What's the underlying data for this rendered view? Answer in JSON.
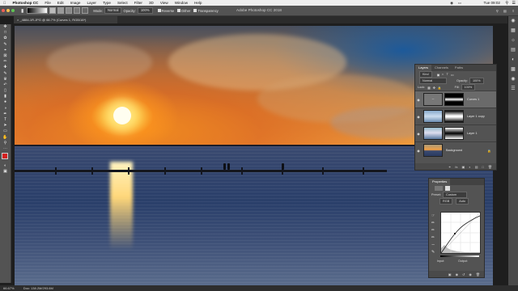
{
  "menubar": {
    "app": "Photoshop CC",
    "items": [
      "File",
      "Edit",
      "Image",
      "Layer",
      "Type",
      "Select",
      "Filter",
      "3D",
      "View",
      "Window",
      "Help"
    ],
    "clock": "Tue 09:02"
  },
  "window": {
    "title": "Adobe Photoshop CC 2018"
  },
  "options": {
    "mode_label": "Mode:",
    "mode_value": "Normal",
    "opacity_label": "Opacity:",
    "opacity_value": "100%",
    "reverse_label": "Reverse",
    "dither_label": "Dither",
    "transparency_label": "Transparency"
  },
  "document_tab": {
    "label": "_4884-1R.JPG @ 66.7% (Curves 1, RGB/16*)"
  },
  "layers_panel": {
    "tabs": [
      "Layers",
      "Channels",
      "Paths"
    ],
    "kind_label": "Kind",
    "blend_mode": "Normal",
    "opacity_label": "Opacity:",
    "opacity_value": "100%",
    "lock_label": "Lock:",
    "fill_label": "Fill:",
    "fill_value": "100%",
    "layers": [
      {
        "name": "Curves 1",
        "selected": true
      },
      {
        "name": "Layer 1 copy",
        "selected": false
      },
      {
        "name": "Layer 1",
        "selected": false
      },
      {
        "name": "Background",
        "selected": false
      }
    ]
  },
  "properties_panel": {
    "title": "Properties",
    "preset_label": "Preset:",
    "preset_value": "Custom",
    "channel_value": "RGB",
    "auto_label": "Auto",
    "input_label": "Input:",
    "output_label": "Output:"
  },
  "status": {
    "zoom": "66.67%",
    "doc": "Doc: 138.2M/293.6M"
  },
  "colors": {
    "panel": "#535353",
    "dark": "#2b2b2b",
    "accent_red": "#d3201f"
  }
}
